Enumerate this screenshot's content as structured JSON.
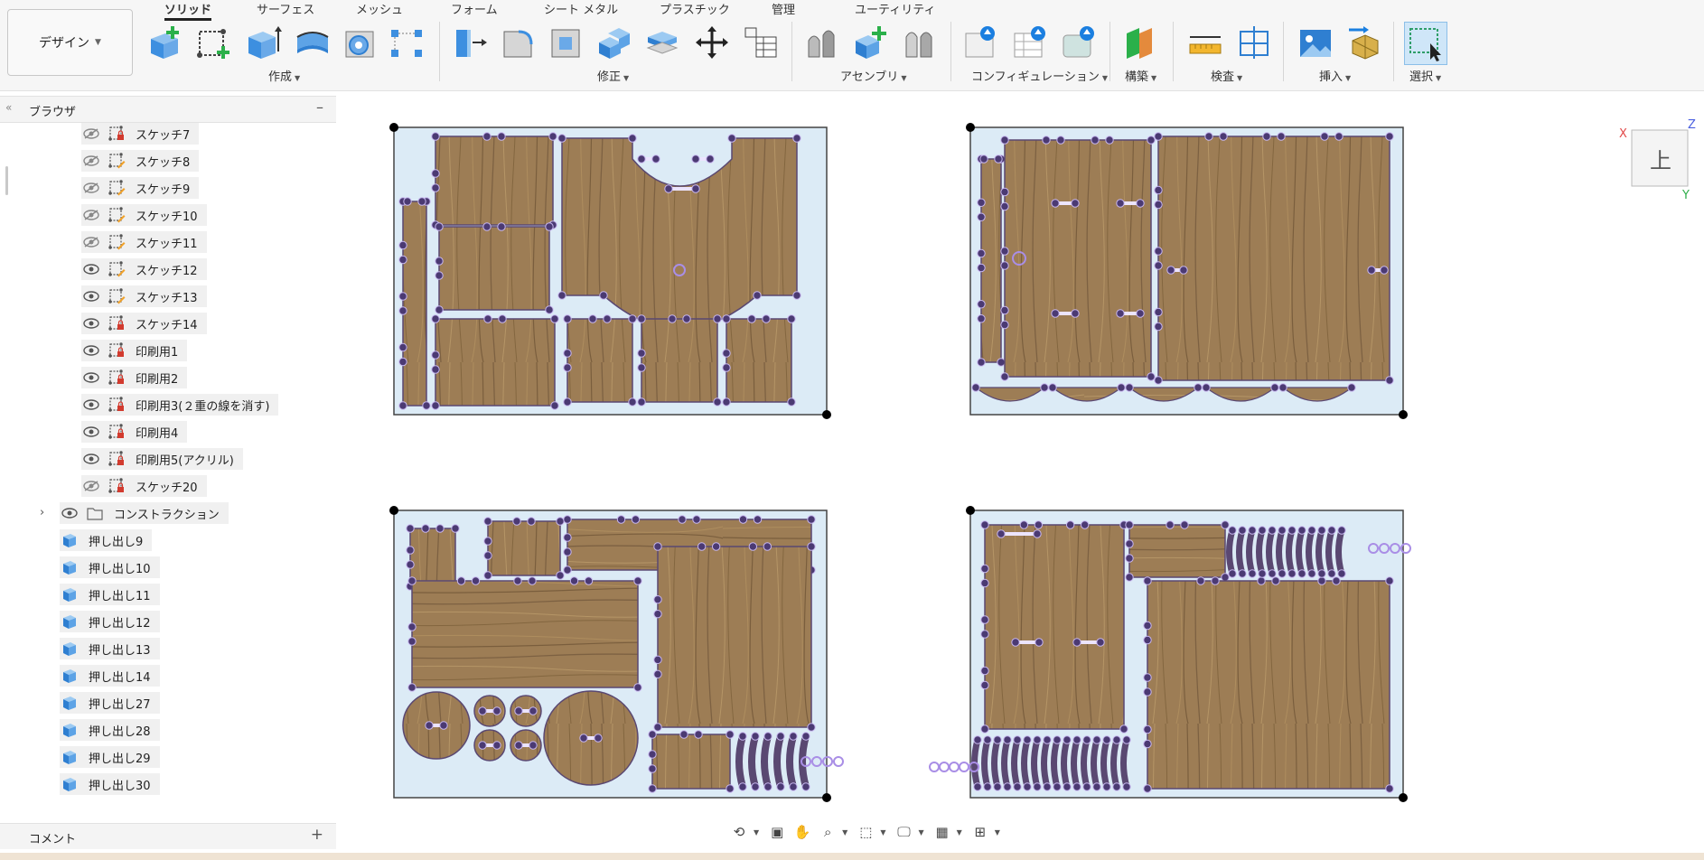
{
  "workspace": {
    "label": "デザイン"
  },
  "tabs": [
    "ソリッド",
    "サーフェス",
    "メッシュ",
    "フォーム",
    "シート メタル",
    "プラスチック",
    "管理",
    "ユーティリティ"
  ],
  "groups": {
    "create": "作成",
    "modify": "修正",
    "assemble": "アセンブリ",
    "configure": "コンフィギュレーション",
    "construct": "構築",
    "inspect": "検査",
    "insert": "挿入",
    "select": "選択"
  },
  "browser": {
    "title": "ブラウザ",
    "items": [
      {
        "label": "スケッチ7",
        "visible": false,
        "type": "sketch-locked"
      },
      {
        "label": "スケッチ8",
        "visible": false,
        "type": "sketch"
      },
      {
        "label": "スケッチ9",
        "visible": false,
        "type": "sketch"
      },
      {
        "label": "スケッチ10",
        "visible": false,
        "type": "sketch"
      },
      {
        "label": "スケッチ11",
        "visible": false,
        "type": "sketch"
      },
      {
        "label": "スケッチ12",
        "visible": true,
        "type": "sketch"
      },
      {
        "label": "スケッチ13",
        "visible": true,
        "type": "sketch"
      },
      {
        "label": "スケッチ14",
        "visible": true,
        "type": "sketch-locked"
      },
      {
        "label": "印刷用1",
        "visible": true,
        "type": "sketch-locked"
      },
      {
        "label": "印刷用2",
        "visible": true,
        "type": "sketch-locked"
      },
      {
        "label": "印刷用3(２重の線を消す)",
        "visible": true,
        "type": "sketch-locked"
      },
      {
        "label": "印刷用4",
        "visible": true,
        "type": "sketch-locked"
      },
      {
        "label": "印刷用5(アクリル)",
        "visible": true,
        "type": "sketch-locked"
      },
      {
        "label": "スケッチ20",
        "visible": false,
        "type": "sketch-locked"
      }
    ],
    "construction": "コンストラクション",
    "extrusions": [
      "押し出し9",
      "押し出し10",
      "押し出し11",
      "押し出し12",
      "押し出し13",
      "押し出し14",
      "押し出し27",
      "押し出し28",
      "押し出し29",
      "押し出し30"
    ]
  },
  "comments": {
    "title": "コメント"
  },
  "viewcube": {
    "face": "上",
    "x": "X",
    "y": "Y",
    "z": "Z"
  },
  "colors": {
    "wood": "#9a7b52",
    "wood_dark": "#7f6340",
    "sheet": "#dcebf6",
    "point": "#4b3a73",
    "accent": "#0b6fd6",
    "constraint": "#a98ee6"
  }
}
